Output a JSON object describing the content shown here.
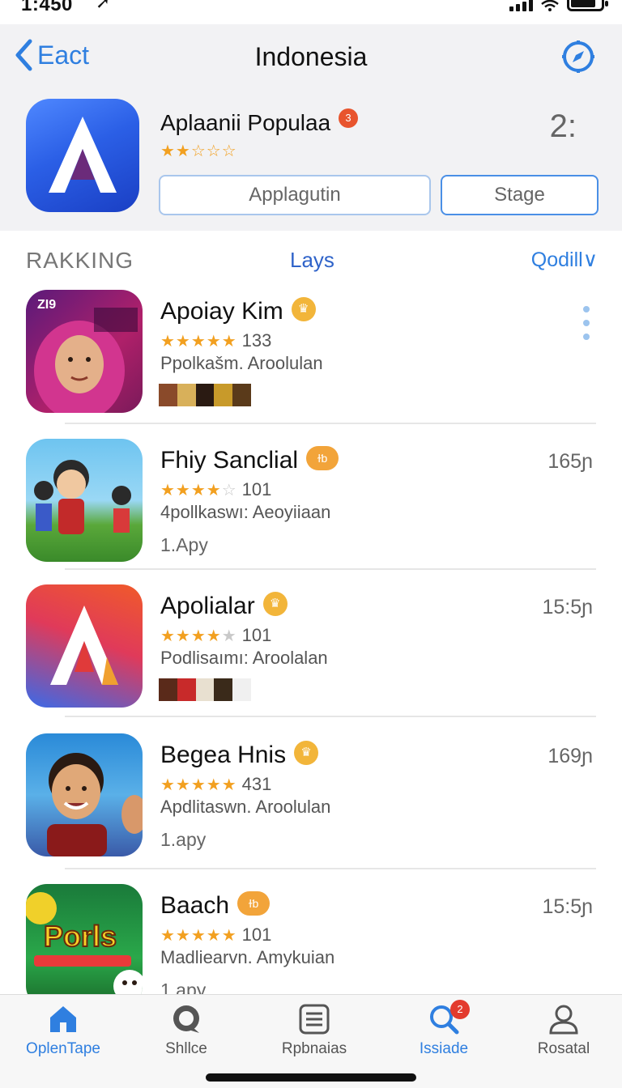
{
  "status_bar": {
    "time": "1:450",
    "arrow": "➚"
  },
  "nav": {
    "back_label": "Eact",
    "title": "Indonesia"
  },
  "featured": {
    "name": "Aplaanii Populaa",
    "badge": "3",
    "rating_display": "★★☆☆☆",
    "rank": "2:",
    "app_button": "Applagutin",
    "stage_button": "Stage"
  },
  "ranking": {
    "label": "RAKKING",
    "days": "Lays",
    "filter": "Qodill∨"
  },
  "apps": [
    {
      "name": "Apoiay Kim",
      "stars": "★★★★★",
      "stars_dim": "",
      "count": "133",
      "category": "Ppolkašm. Aroolulan",
      "time": "",
      "badge_icon": "crown-icon",
      "extra": "",
      "icon_text": "ZI9"
    },
    {
      "name": "Fhiy Sanclial",
      "stars": "★★★★",
      "stars_dim": "☆",
      "count": "101",
      "category": "4pollkaswı: Aeoyiiaan",
      "time": "165ɲ",
      "badge_icon": "ticket-icon",
      "extra": "1.Apy",
      "icon_text": ""
    },
    {
      "name": "Apolialar",
      "stars": "★★★★",
      "stars_dim": "★",
      "count": "101",
      "category": "Podlisaımı: Aroolalan",
      "time": "15:5ɲ",
      "badge_icon": "crown-icon",
      "extra": "",
      "icon_text": ""
    },
    {
      "name": "Begea Hnis",
      "stars": "★★★★★",
      "stars_dim": "",
      "count": "431",
      "category": "Apdlitaswn. Aroolulan",
      "time": "169ɲ",
      "badge_icon": "crown-icon",
      "extra": "1.apy",
      "icon_text": ""
    },
    {
      "name": "Baach",
      "stars": "★★★★★",
      "stars_dim": "",
      "count": "101",
      "category": "Madliearvn. Amykuian",
      "time": "15:5ɲ",
      "badge_icon": "ticket-icon",
      "extra": "1.apy",
      "icon_text": "Porls"
    }
  ],
  "tabs": [
    {
      "label": "OplenTape",
      "icon": "home-icon"
    },
    {
      "label": "Shllce",
      "icon": "chat-icon"
    },
    {
      "label": "Rpbnaias",
      "icon": "list-icon"
    },
    {
      "label": "Issiade",
      "icon": "search-icon",
      "badge": "2"
    },
    {
      "label": "Rosatal",
      "icon": "person-icon"
    }
  ],
  "colors": {
    "accent": "#2f7fe0",
    "star": "#f2a020",
    "crown": "#f2b53a",
    "notify": "#e33b2e"
  }
}
